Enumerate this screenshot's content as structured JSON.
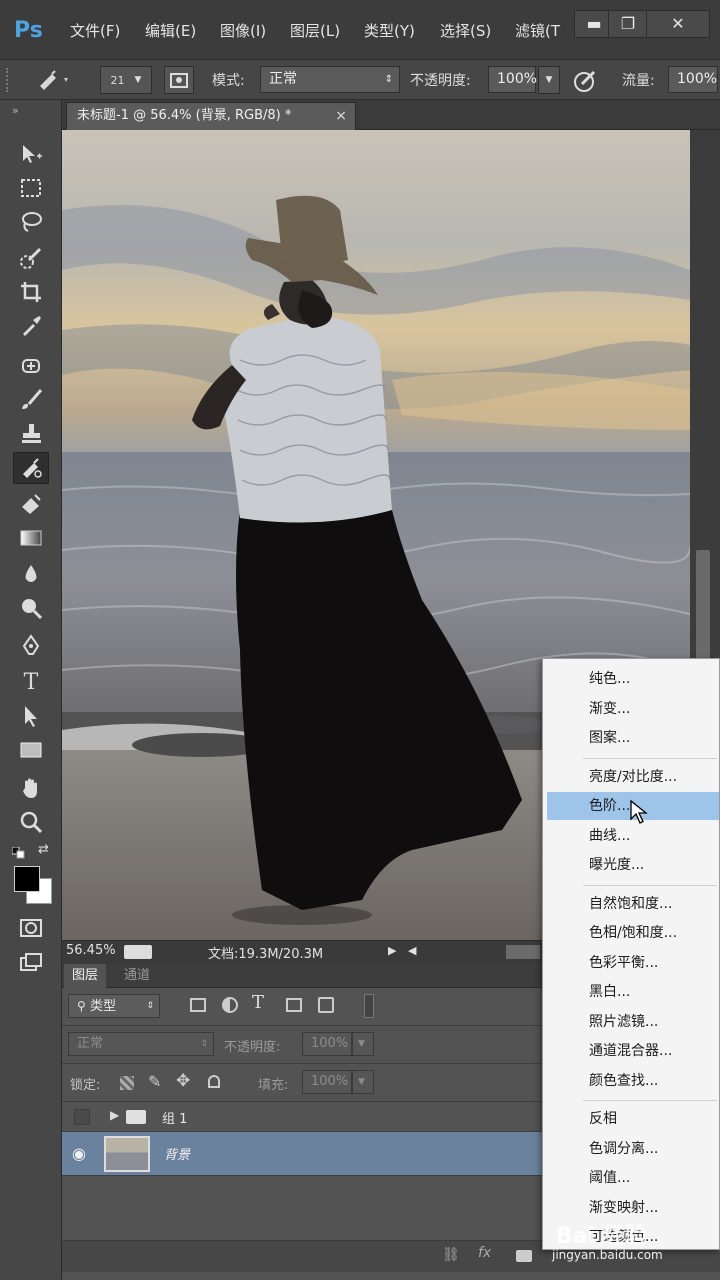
{
  "app": {
    "logo": "Ps"
  },
  "menu": [
    "文件(F)",
    "编辑(E)",
    "图像(I)",
    "图层(L)",
    "类型(Y)",
    "选择(S)",
    "滤镜(T"
  ],
  "window_buttons": {
    "minimize": "▬",
    "restore": "❐",
    "close": "✕"
  },
  "options": {
    "brush_size": "21",
    "mode_label": "模式:",
    "mode_value": "正常",
    "opacity_label": "不透明度:",
    "opacity_value": "100%",
    "flow_label": "流量:",
    "flow_value": "100%"
  },
  "document": {
    "tab_title": "未标题-1 @ 56.4% (背景, RGB/8) *",
    "close": "×"
  },
  "status": {
    "zoom": "56.45%",
    "doc_info": "文档:19.3M/20.3M"
  },
  "layers_panel": {
    "tabs": [
      "图层",
      "通道"
    ],
    "filter_kind": "类型",
    "blend_mode": "正常",
    "opacity_label": "不透明度:",
    "opacity_value": "100%",
    "lock_label": "锁定:",
    "fill_label": "填充:",
    "fill_value": "100%",
    "layers": [
      {
        "name": "组 1",
        "kind": "group"
      },
      {
        "name": "背景",
        "kind": "image",
        "selected": true
      }
    ]
  },
  "context_menu": {
    "groups": [
      [
        "纯色...",
        "渐变...",
        "图案..."
      ],
      [
        "亮度/对比度...",
        "色阶...",
        "曲线...",
        "曝光度..."
      ],
      [
        "自然饱和度...",
        "色相/饱和度...",
        "色彩平衡...",
        "黑白...",
        "照片滤镜...",
        "通道混合器...",
        "颜色查找..."
      ],
      [
        "反相",
        "色调分离...",
        "阈值...",
        "渐变映射...",
        "可选颜色..."
      ]
    ],
    "highlighted": "色阶..."
  },
  "watermark": {
    "text": "Bai 经验",
    "url": "jingyan.baidu.com"
  },
  "colors": {
    "accent": "#4fa3e0",
    "selection": "#6a829e",
    "menu_highlight": "#9fc4ea"
  }
}
